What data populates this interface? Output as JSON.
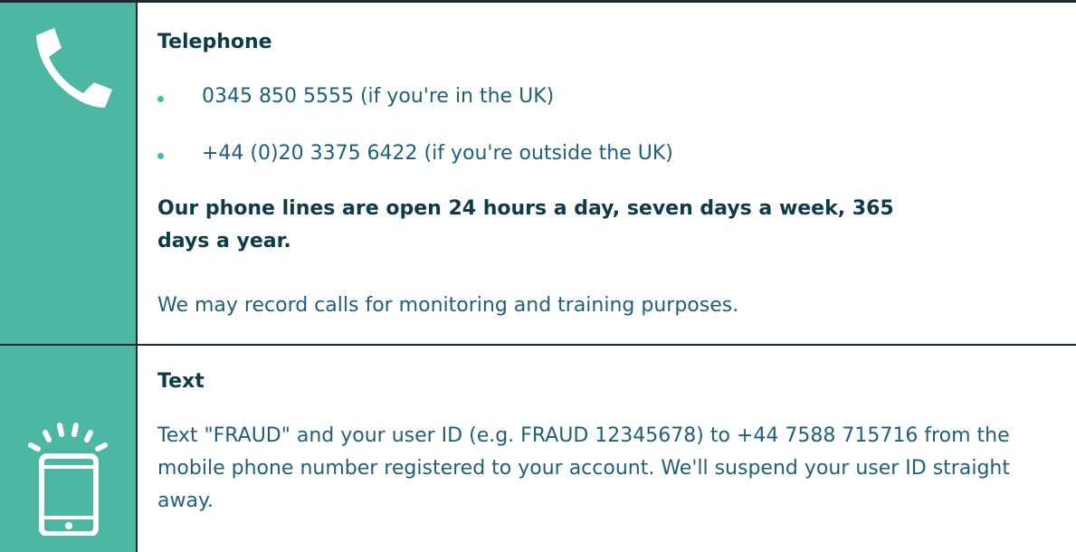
{
  "telephone": {
    "title": "Telephone",
    "icon": "phone-handset-icon",
    "numbers": [
      {
        "text": "0345 850 5555 (if you're in the UK)"
      },
      {
        "text": "+44 (0)20 3375 6422 (if you're outside the UK)"
      }
    ],
    "hours": "Our phone lines are open 24 hours a day, seven days a week, 365 days a year.",
    "note": "We may record calls for monitoring and training purposes."
  },
  "text": {
    "title": "Text",
    "icon": "mobile-phone-ringing-icon",
    "body": "Text \"FRAUD\" and your user ID (e.g. FRAUD 12345678) to +44 7588 715716 from the mobile phone number registered to your account. We'll suspend your user ID straight away."
  },
  "colors": {
    "accent": "#4cb7a3",
    "heading": "#0d3b4a",
    "body": "#1f5f7a",
    "border": "#1e2a30"
  }
}
